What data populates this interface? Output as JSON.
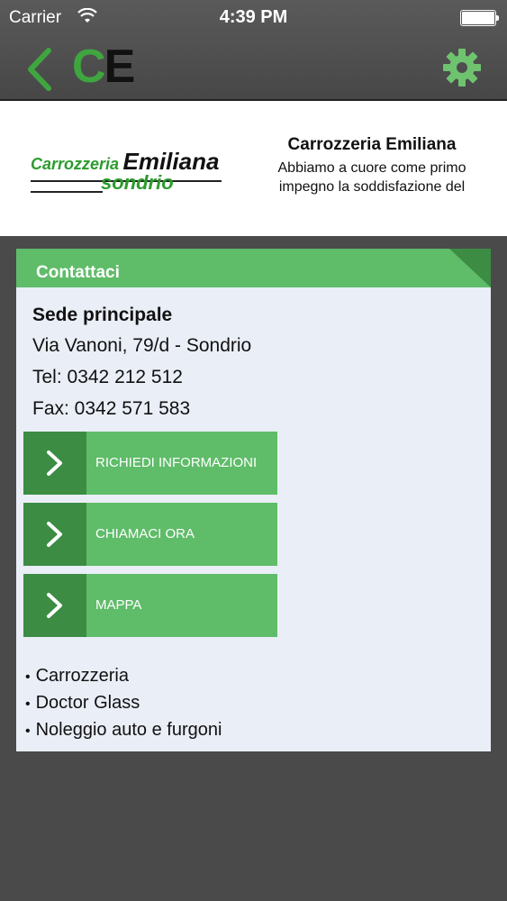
{
  "status_bar": {
    "carrier": "Carrier",
    "time": "4:39 PM"
  },
  "nav": {
    "logo_c": "C",
    "logo_e": "E",
    "icons": [
      "back-chevron-icon",
      "gear-icon"
    ],
    "accent": "#3fa63f"
  },
  "banner": {
    "brand_name_part1": "Carrozzeria",
    "brand_name_part2": "Emiliana",
    "brand_location": "sondrio",
    "title": "Carrozzeria Emiliana",
    "description_line1": "Abbiamo a cuore come primo",
    "description_line2": "impegno la soddisfazione del"
  },
  "card": {
    "header": "Contattaci",
    "heading": "Sede principale",
    "address": "Via Vanoni, 79/d - Sondrio",
    "tel": "Tel: 0342 212 512",
    "fax": "Fax: 0342 571 583",
    "actions": [
      {
        "label": "RICHIEDI INFORMAZIONI"
      },
      {
        "label": "CHIAMACI ORA"
      },
      {
        "label": "MAPPA"
      }
    ],
    "services": [
      "Carrozzeria",
      "Doctor Glass",
      "Noleggio auto e furgoni"
    ]
  },
  "colors": {
    "green": "#5fbc69",
    "dark_green": "#3c8c44",
    "card_bg": "#eaeef7",
    "background": "#4a4a4a"
  }
}
